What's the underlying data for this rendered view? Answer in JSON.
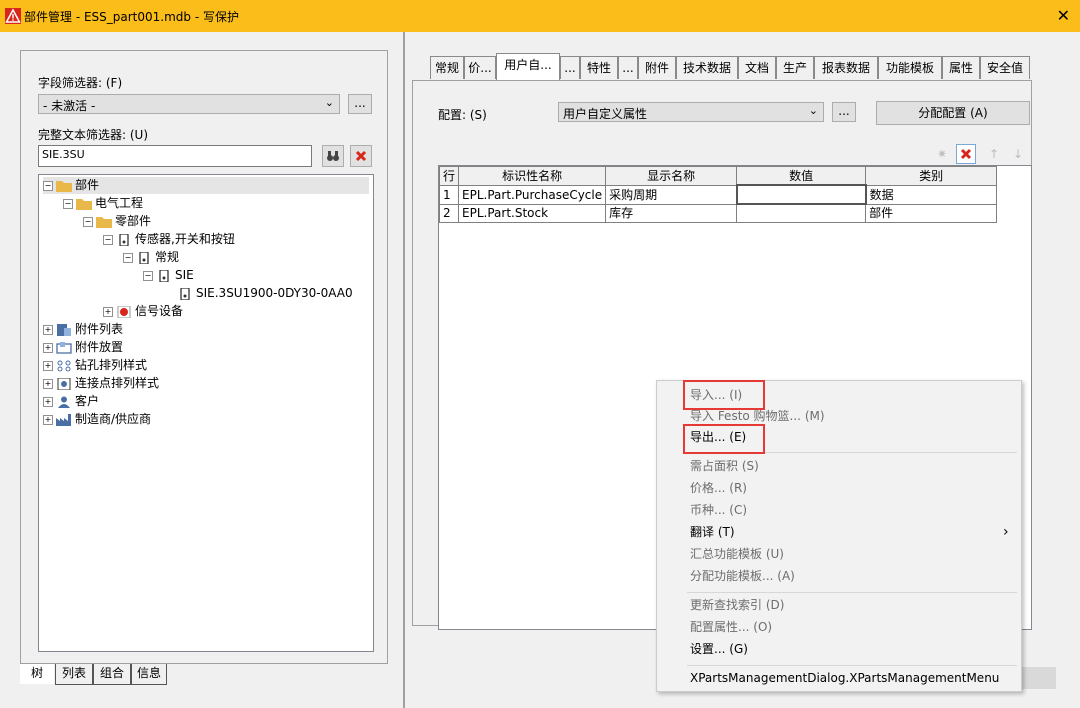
{
  "window": {
    "title": "部件管理 - ESS_part001.mdb - 写保护",
    "close_glyph": "✕"
  },
  "left": {
    "field_filter_label": "字段筛选器: (F)",
    "field_filter_value": "- 未激活 -",
    "fulltext_filter_label": "完整文本筛选器: (U)",
    "fulltext_filter_value": "SIE.3SU",
    "more_button": "...",
    "tree": [
      {
        "label": "部件",
        "icon": "folder-icon",
        "expanded": true
      },
      {
        "label": "电气工程",
        "icon": "folder-icon",
        "expanded": true
      },
      {
        "label": "零部件",
        "icon": "folder-icon",
        "expanded": true
      },
      {
        "label": "传感器,开关和按钮",
        "icon": "switch-icon",
        "expanded": true
      },
      {
        "label": "常规",
        "icon": "switch-icon",
        "expanded": true
      },
      {
        "label": "SIE",
        "icon": "switch-icon",
        "expanded": true
      },
      {
        "label": "SIE.3SU1900-0DY30-0AA0",
        "icon": "switch-icon"
      },
      {
        "label": "信号设备",
        "icon": "signal-icon",
        "expanded": false
      },
      {
        "label": "附件列表",
        "icon": "accessory-list-icon",
        "expanded": false
      },
      {
        "label": "附件放置",
        "icon": "accessory-placement-icon",
        "expanded": false
      },
      {
        "label": "钻孔排列样式",
        "icon": "drill-pattern-icon",
        "expanded": false
      },
      {
        "label": "连接点排列样式",
        "icon": "connection-pattern-icon",
        "expanded": false
      },
      {
        "label": "客户",
        "icon": "customer-icon",
        "expanded": false
      },
      {
        "label": "制造商/供应商",
        "icon": "manufacturer-icon",
        "expanded": false
      }
    ],
    "bottom_tabs": [
      "树",
      "列表",
      "组合",
      "信息"
    ]
  },
  "right": {
    "tabs": [
      "常规",
      "价...",
      "用户自...",
      "...",
      "特性",
      "...",
      "附件",
      "技术数据",
      "文档",
      "生产",
      "报表数据",
      "功能模板",
      "属性",
      "安全值"
    ],
    "active_tab": "用户自...",
    "config_label": "配置: (S)",
    "config_value": "用户自定义属性",
    "config_more": "...",
    "assign_button": "分配配置 (A)",
    "grid": {
      "headers": [
        "行",
        "标识性名称",
        "显示名称",
        "数值",
        "类别"
      ],
      "rows": [
        [
          "1",
          "EPL.Part.PurchaseCycle",
          "采购周期",
          "",
          "数据"
        ],
        [
          "2",
          "EPL.Part.Stock",
          "库存",
          "",
          "部件"
        ]
      ]
    }
  },
  "context_menu": {
    "items": [
      {
        "label": "导入... (I)",
        "disabled": true
      },
      {
        "label": "导入 Festo 购物篮... (M)",
        "disabled": true
      },
      {
        "label": "导出... (E)",
        "disabled": false
      },
      {
        "label": "需占面积 (S)",
        "disabled": true
      },
      {
        "label": "价格... (R)",
        "disabled": true
      },
      {
        "label": "币种... (C)",
        "disabled": true
      },
      {
        "label": "翻译 (T)",
        "disabled": false,
        "submenu": "›"
      },
      {
        "label": "汇总功能模板 (U)",
        "disabled": true
      },
      {
        "label": "分配功能模板... (A)",
        "disabled": true
      },
      {
        "label": "更新查找索引 (D)",
        "disabled": true
      },
      {
        "label": "配置属性... (O)",
        "disabled": true
      },
      {
        "label": "设置... (G)",
        "disabled": false
      },
      {
        "label": "XPartsManagementDialog.XPartsManagementMenu",
        "disabled": false
      }
    ]
  },
  "colors": {
    "title_bar": "#fbbd19",
    "highlight_box": "#e53935",
    "delete_red": "#d9261c"
  }
}
